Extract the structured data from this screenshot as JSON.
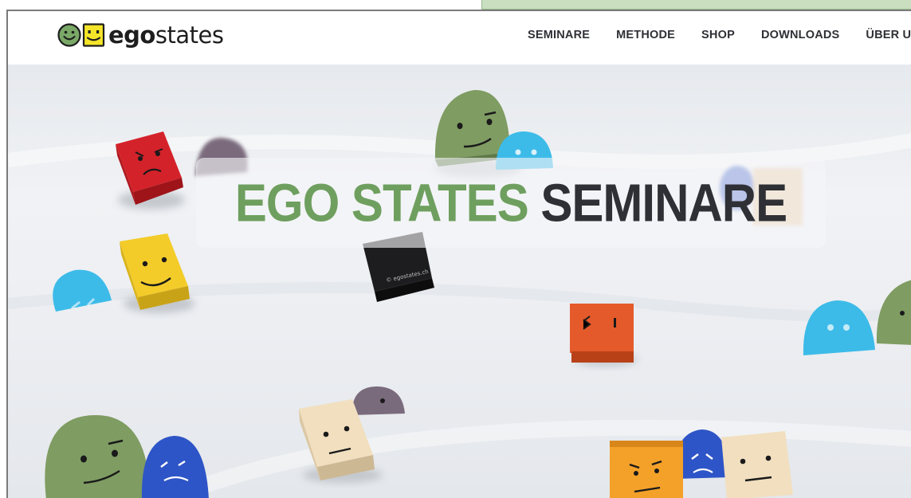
{
  "brand": {
    "logo_part1": "ego",
    "logo_part2": "states",
    "colors": {
      "green": "#7aa867",
      "yellow": "#f5e52a",
      "dark": "#2f3035"
    }
  },
  "nav": {
    "items": [
      "SEMINARE",
      "METHODE",
      "SHOP",
      "DOWNLOADS",
      "ÜBER UN"
    ]
  },
  "hero": {
    "title_part1": "EGO STATES",
    "title_part2": "SEMINARE",
    "colors": {
      "title_green": "#6e9f5f",
      "title_dark": "#2f3035"
    }
  }
}
